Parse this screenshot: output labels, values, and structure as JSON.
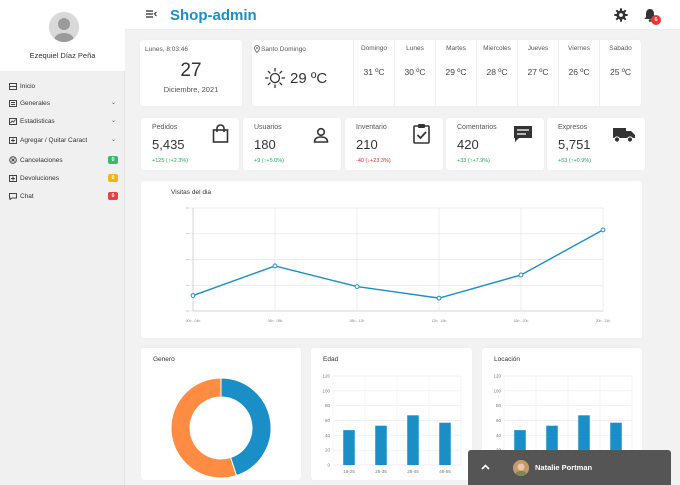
{
  "app": {
    "brand": "Shop-admin",
    "notification_count": "6"
  },
  "user": {
    "name": "Ezequiel Díaz Peña"
  },
  "sidebar": {
    "items": [
      {
        "label": "Inicio",
        "icon": "dashboard-icon"
      },
      {
        "label": "Generales",
        "icon": "list-icon",
        "chevron": "⌄"
      },
      {
        "label": "Estadisticas",
        "icon": "chart-icon",
        "chevron": "⌄"
      },
      {
        "label": "Agregar / Quitar Caract",
        "icon": "plus-square-icon",
        "chevron": "⌄"
      },
      {
        "label": "Cancelaciones",
        "icon": "cancel-icon",
        "badge": "0",
        "badge_color": "#3bb86a"
      },
      {
        "label": "Devoluciones",
        "icon": "return-icon",
        "badge": "0",
        "badge_color": "#f2b61b"
      },
      {
        "label": "Chat",
        "icon": "chat-icon",
        "badge": "0",
        "badge_color": "#e04444"
      }
    ]
  },
  "date_card": {
    "day_label": "Lunes, 8:03:46",
    "day": "27",
    "month_year": "Diciembre, 2021"
  },
  "weather": {
    "city": "Santo Domingo",
    "current_temp": "29 ºC",
    "days": [
      {
        "name": "Domingo",
        "temp": "31 ºC"
      },
      {
        "name": "Lunes",
        "temp": "30 ºC"
      },
      {
        "name": "Martes",
        "temp": "29 ºC"
      },
      {
        "name": "Miercoles",
        "temp": "28 ºC"
      },
      {
        "name": "Jueves",
        "temp": "27 ºC"
      },
      {
        "name": "Viernes",
        "temp": "26 ºC"
      },
      {
        "name": "Sabado",
        "temp": "25 ºC"
      }
    ]
  },
  "stats": [
    {
      "label": "Pedidos",
      "value": "5,435",
      "change": "+125  (↑+2.3%)",
      "trend": "up",
      "icon": "shopping-bag-icon"
    },
    {
      "label": "Usuarios",
      "value": "180",
      "change": "+9  (↑+5.0%)",
      "trend": "up",
      "icon": "user-icon"
    },
    {
      "label": "Inventario",
      "value": "210",
      "change": "-40  (↓+23.3%)",
      "trend": "down",
      "icon": "clipboard-check-icon"
    },
    {
      "label": "Comentarios",
      "value": "420",
      "change": "+33  (↑+7.9%)",
      "trend": "up",
      "icon": "comment-icon"
    },
    {
      "label": "Expresos",
      "value": "5,751",
      "change": "+53  (↑+0.9%)",
      "trend": "up",
      "icon": "truck-icon"
    }
  ],
  "chart_data": [
    {
      "type": "line",
      "title": "Visitas del dia",
      "x": [
        "00h - 04h",
        "04h - 08h",
        "08h - 12h",
        "12h - 16h",
        "16h - 20h",
        "20h - 24h"
      ],
      "values": [
        12,
        35,
        19,
        10,
        28,
        63
      ],
      "ylim": [
        0,
        80
      ],
      "color": "#1a8fc7",
      "grid": true
    },
    {
      "type": "pie",
      "title": "Genero",
      "slices": [
        45,
        55
      ],
      "colors": [
        "#1a8fc7",
        "#ff8c42"
      ],
      "donut": true
    },
    {
      "type": "bar",
      "title": "Edad",
      "categories": [
        "18-25",
        "25-35",
        "35-45",
        "45-55"
      ],
      "values": [
        47,
        53,
        67,
        57
      ],
      "ylim": [
        0,
        120
      ],
      "yticks": [
        "0",
        "20",
        "40",
        "60",
        "80",
        "100",
        "120"
      ],
      "color": "#1a8fc7"
    },
    {
      "type": "bar",
      "title": "Locación",
      "categories": [
        "",
        "",
        "",
        ""
      ],
      "values": [
        47,
        53,
        67,
        57
      ],
      "ylim": [
        0,
        120
      ],
      "yticks": [
        "0",
        "20",
        "40",
        "60",
        "80",
        "100",
        "120"
      ],
      "color": "#1a8fc7"
    }
  ],
  "chat": {
    "name": "Natalie Portman"
  }
}
